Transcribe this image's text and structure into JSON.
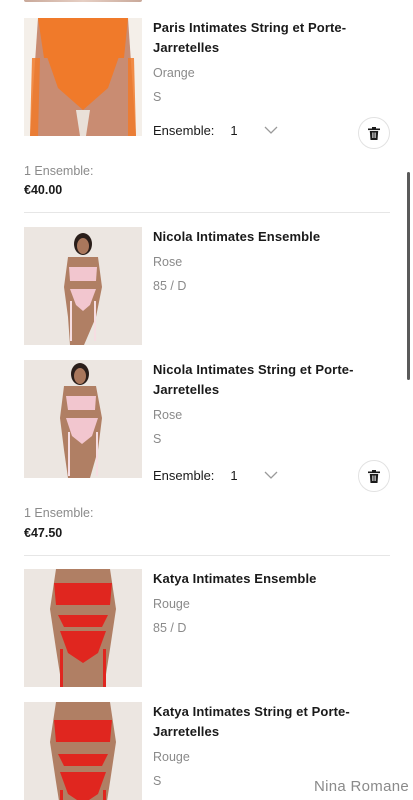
{
  "cart": {
    "groups": [
      {
        "items": [
          {
            "title": "Paris Intimates String et Porte-Jarretelles",
            "color": "Orange",
            "size": "S",
            "qty_label": "Ensemble:",
            "qty_value": "1",
            "image_tone": "#f07a2a"
          }
        ],
        "subtotal_label": "1 Ensemble:",
        "subtotal_value": "€40.00"
      },
      {
        "items": [
          {
            "title": "Nicola Intimates Ensemble",
            "color": "Rose",
            "size": "85 / D",
            "image_tone": "#f2c6cf"
          },
          {
            "title": "Nicola Intimates String et Porte-Jarretelles",
            "color": "Rose",
            "size": "S",
            "qty_label": "Ensemble:",
            "qty_value": "1",
            "image_tone": "#f2c6cf"
          }
        ],
        "subtotal_label": "1 Ensemble:",
        "subtotal_value": "€47.50"
      },
      {
        "items": [
          {
            "title": "Katya Intimates Ensemble",
            "color": "Rouge",
            "size": "85 / D",
            "image_tone": "#e0261f"
          },
          {
            "title": "Katya Intimates String et Porte-Jarretelles",
            "color": "Rouge",
            "size": "S",
            "image_tone": "#e0261f"
          }
        ]
      }
    ]
  },
  "watermark": "Nina Romane",
  "icons": {
    "trash": "trash-icon",
    "chevron": "chevron-down-icon"
  }
}
